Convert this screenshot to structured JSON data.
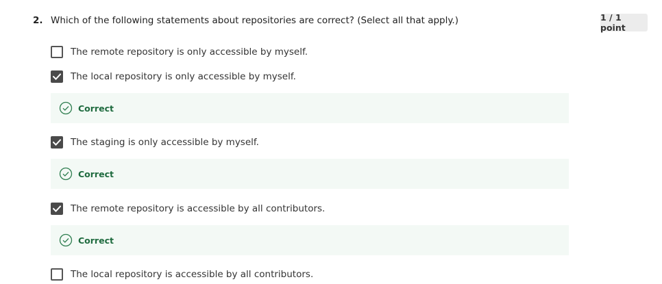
{
  "question": {
    "number": "2.",
    "text": "Which of the following statements about repositories are correct? (Select all that apply.)",
    "score": "1 / 1 point"
  },
  "options": [
    {
      "label": "The remote repository is only accessible by myself.",
      "checked": false
    },
    {
      "label": "The local repository is only accessible by myself.",
      "checked": true,
      "feedback": "Correct"
    },
    {
      "label": "The staging is only accessible by myself.",
      "checked": true,
      "feedback": "Correct"
    },
    {
      "label": "The remote repository is accessible by all contributors.",
      "checked": true,
      "feedback": "Correct"
    },
    {
      "label": "The local repository is accessible by all contributors.",
      "checked": false
    }
  ],
  "colors": {
    "correct_text": "#1f6b3f",
    "feedback_bg": "#f3f9f5",
    "checkbox_checked": "#4a4a4a"
  },
  "icons": {
    "feedback": "check-circle-icon",
    "checkbox_checked": "checkmark-icon"
  }
}
